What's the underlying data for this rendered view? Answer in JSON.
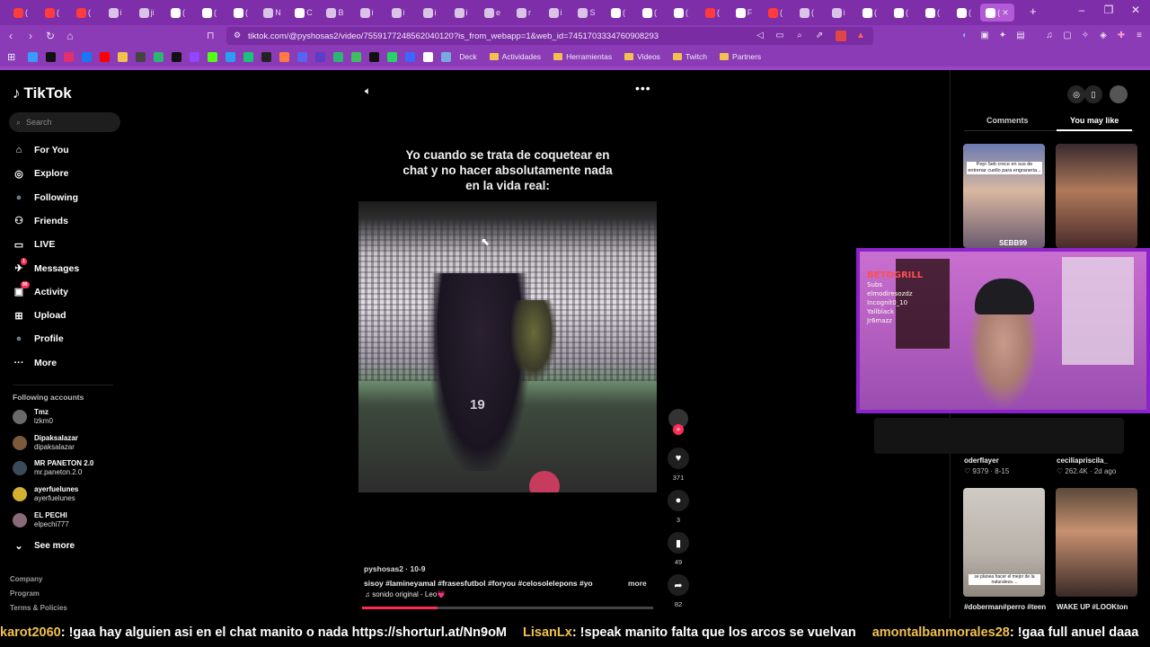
{
  "browser": {
    "tabs": [
      {
        "label": "(",
        "icon": "youtube-icon",
        "color": "#ff3b3b"
      },
      {
        "label": "(",
        "icon": "youtube-icon",
        "color": "#ff3b3b"
      },
      {
        "label": "(",
        "icon": "youtube-icon",
        "color": "#ff3b3b"
      },
      {
        "label": "i",
        "icon": "globe-icon",
        "color": "#d9c3e6"
      },
      {
        "label": "ji",
        "icon": "globe-icon",
        "color": "#d9c3e6"
      },
      {
        "label": "(",
        "icon": "x-icon",
        "color": "#ffffff"
      },
      {
        "label": "(",
        "icon": "x-icon",
        "color": "#ffffff"
      },
      {
        "label": "(",
        "icon": "x-icon",
        "color": "#ffffff"
      },
      {
        "label": "N",
        "icon": "globe-icon",
        "color": "#d9c3e6"
      },
      {
        "label": "C",
        "icon": "grid-icon",
        "color": "#ffffff"
      },
      {
        "label": "B",
        "icon": "globe-icon",
        "color": "#d9c3e6"
      },
      {
        "label": "i",
        "icon": "globe-icon",
        "color": "#d9c3e6"
      },
      {
        "label": "i",
        "icon": "globe-icon",
        "color": "#d9c3e6"
      },
      {
        "label": "i",
        "icon": "globe-icon",
        "color": "#d9c3e6"
      },
      {
        "label": "i",
        "icon": "globe-icon",
        "color": "#d9c3e6"
      },
      {
        "label": "e",
        "icon": "globe-icon",
        "color": "#d9c3e6"
      },
      {
        "label": "r",
        "icon": "globe-icon",
        "color": "#d9c3e6"
      },
      {
        "label": "i",
        "icon": "globe-icon",
        "color": "#d9c3e6"
      },
      {
        "label": "S",
        "icon": "globe-icon",
        "color": "#d9c3e6"
      },
      {
        "label": "(",
        "icon": "grid-icon",
        "color": "#ffffff"
      },
      {
        "label": "(",
        "icon": "tiktok-icon",
        "color": "#ffffff"
      },
      {
        "label": "(",
        "icon": "tiktok-icon",
        "color": "#ffffff"
      },
      {
        "label": "(",
        "icon": "youtube-icon",
        "color": "#ff3b3b"
      },
      {
        "label": "F",
        "icon": "tiktok-icon",
        "color": "#ffffff"
      },
      {
        "label": "(",
        "icon": "youtube-icon",
        "color": "#ff3b3b"
      },
      {
        "label": "(",
        "icon": "globe-icon",
        "color": "#d9c3e6"
      },
      {
        "label": "i",
        "icon": "globe-icon",
        "color": "#d9c3e6"
      },
      {
        "label": "(",
        "icon": "tiktok-icon",
        "color": "#ffffff"
      },
      {
        "label": "(",
        "icon": "tiktok-icon",
        "color": "#ffffff"
      },
      {
        "label": "(",
        "icon": "tiktok-icon",
        "color": "#ffffff"
      },
      {
        "label": "(",
        "icon": "tiktok-icon",
        "color": "#ffffff"
      },
      {
        "label": "(",
        "icon": "tiktok-icon",
        "color": "#ffffff",
        "active": true
      }
    ],
    "url": "tiktok.com/@pyshosas2/video/7559177248562040120?is_from_webapp=1&web_id=7451703334760908293",
    "bookmarks_folders": [
      "Deck",
      "Actividades",
      "Herramientas",
      "Videos",
      "Twitch",
      "Partners"
    ],
    "accent": "#7d2ea8"
  },
  "tiktok": {
    "logo": "TikTok",
    "search_placeholder": "Search",
    "nav": [
      {
        "label": "For You",
        "icon": "home-icon"
      },
      {
        "label": "Explore",
        "icon": "compass-icon"
      },
      {
        "label": "Following",
        "icon": "avatar-icon"
      },
      {
        "label": "Friends",
        "icon": "friends-icon"
      },
      {
        "label": "LIVE",
        "icon": "live-icon"
      },
      {
        "label": "Messages",
        "icon": "messages-icon",
        "badge": "1"
      },
      {
        "label": "Activity",
        "icon": "activity-icon",
        "badge": "99"
      },
      {
        "label": "Upload",
        "icon": "upload-icon"
      },
      {
        "label": "Profile",
        "icon": "profile-icon"
      },
      {
        "label": "More",
        "icon": "more-icon"
      }
    ],
    "following_header": "Following accounts",
    "accounts": [
      {
        "name": "Tmz",
        "handle": "lzkm0",
        "color": "#6a6a6a"
      },
      {
        "name": "Dipaksalazar",
        "handle": "dipaksalazar",
        "color": "#7a5a3a"
      },
      {
        "name": "MR PANETON 2.0",
        "handle": "mr.paneton.2.0",
        "color": "#3a4a5a"
      },
      {
        "name": "ayerfuelunes",
        "handle": "ayerfuelunes",
        "color": "#d4b030"
      },
      {
        "name": "EL PECHI",
        "handle": "elpechi777",
        "color": "#8a6a7a"
      }
    ],
    "see_more": "See more",
    "footer": [
      "Company",
      "Program",
      "Terms & Policies"
    ]
  },
  "video": {
    "caption": "Yo cuando se trata de coquetear en chat y no hacer absolutamente nada en la vida real:",
    "author": "pyshosas2 · 10-9",
    "description": "sisoy #lamineyamal #frasesfutbol #foryou #celosolelepons #yo",
    "more": "more",
    "sound": "♫ sonido original - Leo💗",
    "likes": "371",
    "comments": "3",
    "saves": "49",
    "shares": "82",
    "progress": 0.26,
    "jersey_number": "19"
  },
  "right_panel": {
    "tabs": [
      "Comments",
      "You may like"
    ],
    "active_tab": "You may like",
    "thumbs": [
      {
        "user": "",
        "meta": ""
      },
      {
        "user": "",
        "meta": ""
      },
      {
        "user": "oderflayer",
        "meta": "♡ 9379 · 8-15"
      },
      {
        "user": "ceciliapriscila_",
        "meta": "♡ 262.4K · 2d ago"
      },
      {
        "user": "#doberman#perro #teen",
        "meta": ""
      },
      {
        "user": "WAKE UP #LOOKton",
        "meta": ""
      }
    ],
    "thumb_overlay_1": "Pepi Seb crece en sus de entrenar cuello para engraneria...",
    "thumb_overlay_1b": "SEBB99",
    "thumb_overlay_5": "se planea hacer el mejor de la naturaleza ..."
  },
  "webcam": {
    "overlay_title": "BETOGRILL",
    "overlay_lines": [
      "Subs",
      "elmodiresozdz",
      "Incognit0_10",
      "Yallblack",
      "Jr6mazz"
    ]
  },
  "chat": [
    {
      "user": "karot2060",
      "msg": ": !gaa hay alguien asi en el chat manito o nada https://shorturl.at/Nn9oM"
    },
    {
      "user": "LisanLx",
      "msg": ": !speak manito falta que los arcos se vuelvan"
    },
    {
      "user": "amontalbanmorales28",
      "msg": ": !gaa full anuel daaa"
    }
  ]
}
